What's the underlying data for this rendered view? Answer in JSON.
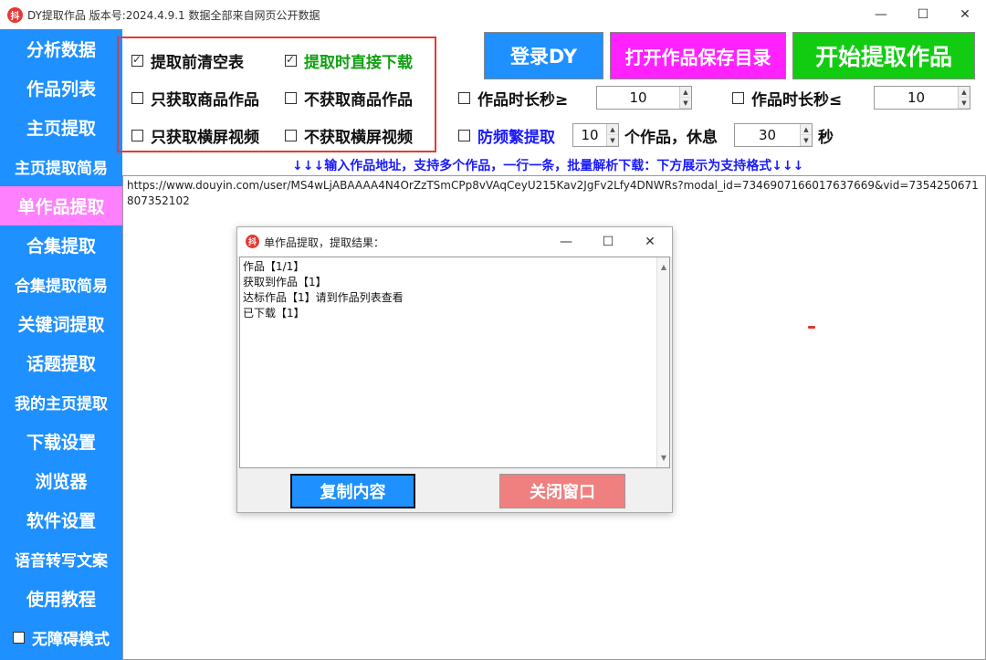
{
  "titlebar": {
    "icon_glyph": "抖",
    "title": "DY提取作品    版本号:2024.4.9.1  数据全部来自网页公开数据",
    "minimize": "—",
    "maximize": "☐",
    "close": "✕"
  },
  "sidebar": {
    "items": [
      {
        "label": "分析数据"
      },
      {
        "label": "作品列表"
      },
      {
        "label": "主页提取"
      },
      {
        "label": "主页提取简易"
      },
      {
        "label": "单作品提取"
      },
      {
        "label": "合集提取"
      },
      {
        "label": "合集提取简易"
      },
      {
        "label": "关键词提取"
      },
      {
        "label": "话题提取"
      },
      {
        "label": "我的主页提取"
      },
      {
        "label": "下载设置"
      },
      {
        "label": "浏览器"
      },
      {
        "label": "软件设置"
      },
      {
        "label": "语音转写文案"
      },
      {
        "label": "使用教程"
      }
    ],
    "accessibility_label": "无障碍模式"
  },
  "options": {
    "clear_before": "提取前清空表",
    "download_direct": "提取时直接下载",
    "only_goods": "只获取商品作品",
    "no_goods": "不获取商品作品",
    "only_landscape": "只获取横屏视频",
    "no_landscape": "不获取横屏视频",
    "duration_min_label": "作品时长秒≥",
    "duration_min_value": "10",
    "duration_max_label": "作品时长秒≤",
    "duration_max_value": "10",
    "anti_freq_label": "防频繁提取",
    "anti_freq_count": "10",
    "anti_freq_mid": "个作品，休息",
    "anti_freq_rest": "30",
    "anti_freq_unit": "秒"
  },
  "buttons": {
    "login": "登录DY",
    "open_dir": "打开作品保存目录",
    "start": "开始提取作品"
  },
  "hint": "↓↓↓输入作品地址，支持多个作品，一行一条，批量解析下载：下方展示为支持格式↓↓↓",
  "input_text": "https://www.douyin.com/user/MS4wLjABAAAA4N4OrZzTSmCPp8vVAqCeyU215Kav2JgFv2Lfy4DNWRs?modal_id=7346907166017637669&vid=7354250671807352102",
  "dialog": {
    "title": "单作品提取，提取结果：",
    "lines": [
      "作品【1/1】",
      "获取到作品【1】",
      "达标作品【1】请到作品列表查看",
      "已下载【1】"
    ],
    "copy_button": "复制内容",
    "close_button": "关闭窗口"
  },
  "colors": {
    "sidebar": "#1e90ff",
    "active_nav": "#ff80ff",
    "login_btn": "#1e90ff",
    "open_dir_btn": "#ff22ff",
    "start_btn": "#11cc11",
    "copy_btn": "#1e90ff",
    "close_btn": "#f08080",
    "highlight_green": "#11a011",
    "anti_freq_blue": "#1a1aff"
  }
}
